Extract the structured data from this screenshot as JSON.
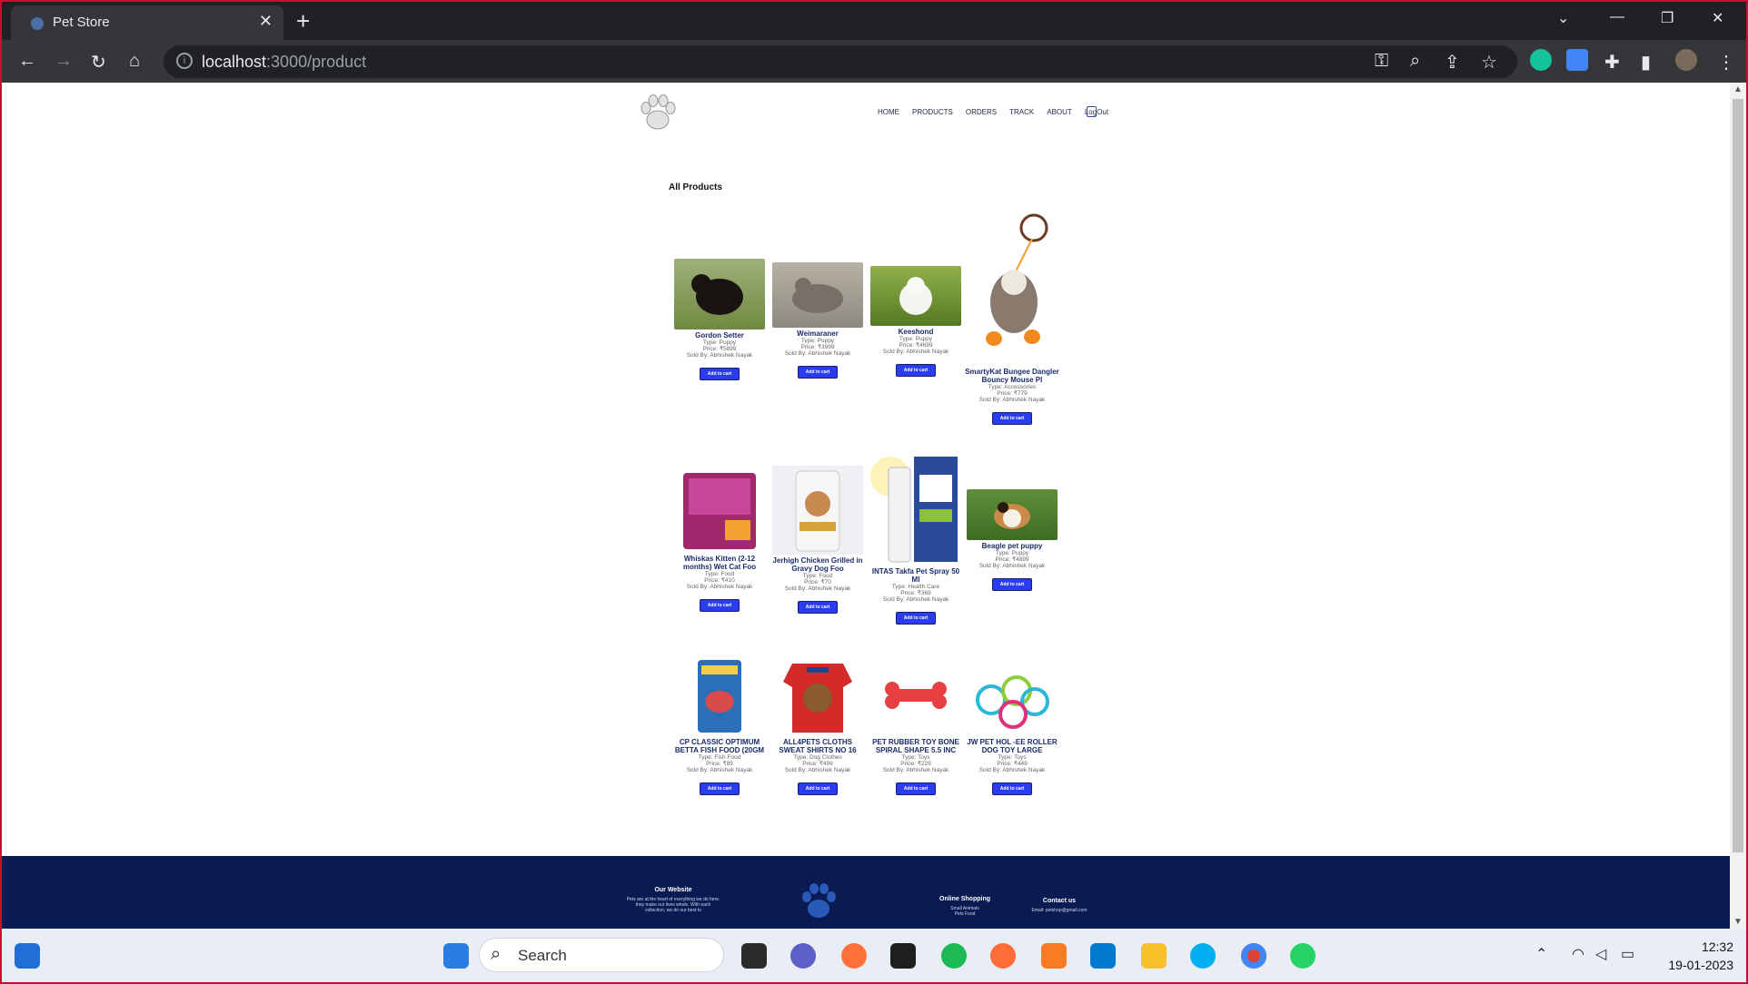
{
  "browser": {
    "tab_title": "Pet Store",
    "url_host": "localhost",
    "url_path": ":3000/product"
  },
  "nav": {
    "items": [
      "HOME",
      "PRODUCTS",
      "ORDERS",
      "TRACK",
      "ABOUT",
      "LogOut"
    ]
  },
  "section_title": "All Products",
  "button_label": "Add to cart",
  "products": [
    {
      "name": "Gordon Setter",
      "type": "Type: Puppy",
      "price": "Price: ₹5899",
      "seller": "Sold By: Abhishek Nayak"
    },
    {
      "name": "Weimaraner",
      "type": "Type: Puppy",
      "price": "Price: ₹3999",
      "seller": "Sold By: Abhishek Nayak"
    },
    {
      "name": "Keeshond",
      "type": "Type: Puppy",
      "price": "Price: ₹4699",
      "seller": "Sold By: Abhishek Nayak"
    },
    {
      "name": "SmartyKat Bungee Dangler Bouncy Mouse Pl",
      "type": "Type: Accessories",
      "price": "Price: ₹779",
      "seller": "Sold By: Abhishek Nayak"
    },
    {
      "name": "Whiskas Kitten (2-12 months) Wet Cat Foo",
      "type": "Type: Food",
      "price": "Price: ₹410",
      "seller": "Sold By: Abhishek Nayak"
    },
    {
      "name": "Jerhigh Chicken Grilled in Gravy Dog Foo",
      "type": "Type: Food",
      "price": "Price: ₹70",
      "seller": "Sold By: Abhishek Nayak"
    },
    {
      "name": "INTAS Takfa Pet Spray 50 Ml",
      "type": "Type: Health Care",
      "price": "Price: ₹369",
      "seller": "Sold By: Abhishek Nayak"
    },
    {
      "name": "Beagle pet puppy",
      "type": "Type: Puppy",
      "price": "Price: ₹4899",
      "seller": "Sold By: Abhishek Nayak"
    },
    {
      "name": "CP CLASSIC OPTIMUM BETTA FISH FOOD (20GM",
      "type": "Type: Fish Food",
      "price": "Price: ₹89",
      "seller": "Sold By: Abhishek Nayak"
    },
    {
      "name": "ALL4PETS CLOTHS SWEAT SHIRTS NO 16",
      "type": "Type: Dog Clothes",
      "price": "Price: ₹499",
      "seller": "Sold By: Abhishek Nayak"
    },
    {
      "name": "PET RUBBER TOY BONE SPIRAL SHAPE 5.5 INC",
      "type": "Type: Toys",
      "price": "Price: ₹229",
      "seller": "Sold By: Abhishek Nayak"
    },
    {
      "name": "JW PET HOL -EE ROLLER DOG TOY LARGE",
      "type": "Type: Toys",
      "price": "Price: ₹449",
      "seller": "Sold By: Abhishek Nayak"
    }
  ],
  "footer": {
    "website_title": "Our Website",
    "website_text": "Pets are at the heart of everything we do here. they make our lives whole. With each collection, we do our best to",
    "shopping_title": "Online Shopping",
    "shopping_items": [
      "Small Animals",
      "Pets Food"
    ],
    "contact_title": "Contact us",
    "contact_email": "Email: petshop@gmail.com"
  },
  "taskbar": {
    "search_label": "Search",
    "time": "12:32",
    "date": "19-01-2023"
  }
}
